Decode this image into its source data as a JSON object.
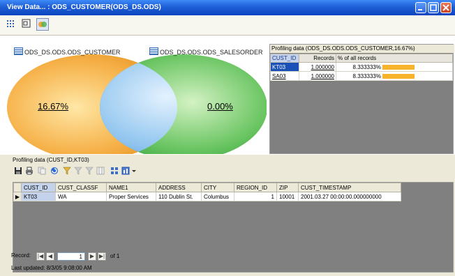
{
  "window": {
    "title": "View Data... : ODS_CUSTOMER(ODS_DS.ODS)"
  },
  "viewbar": {
    "buttons": [
      "grid-view",
      "table-view",
      "venn-view"
    ]
  },
  "venn": {
    "left_set": "ODS_DS.ODS.ODS_CUSTOMER",
    "right_set": "ODS_DS.ODS.ODS_SALESORDER",
    "left_pct": "16.67%",
    "right_pct": "0.00%",
    "colors": {
      "left": "#f6a93b",
      "right": "#5cbf5c",
      "overlap": "#8cc3f0"
    }
  },
  "profiling_right": {
    "caption": "Profiling data (ODS_DS.ODS.ODS_CUSTOMER,16.67%)",
    "headers": [
      "CUST_ID",
      "Records",
      "% of all records"
    ],
    "rows": [
      {
        "id": "KT03",
        "records": "1.000000",
        "pct": "8.333333%",
        "fraction": 0.0833
      },
      {
        "id": "SA03",
        "records": "1.000000",
        "pct": "8.333333%",
        "fraction": 0.0833
      }
    ]
  },
  "profiling_lower": {
    "caption": "Profiling data (CUST_ID,KT03)",
    "headers": [
      "CUST_ID",
      "CUST_CLASSF",
      "NAME1",
      "ADDRESS",
      "CITY",
      "REGION_ID",
      "ZIP",
      "CUST_TIMESTAMP"
    ],
    "rows": [
      [
        "KT03",
        "WA",
        "Proper Services",
        "110 Dublin St.",
        "Columbus",
        "1",
        "10001",
        "2001.03.27 00:00:00.000000000"
      ]
    ]
  },
  "navigator": {
    "label": "Record:",
    "current": "1",
    "of_label": "of 1"
  },
  "status": {
    "text": "Last updated: 8/3/05 9:08:00 AM"
  }
}
